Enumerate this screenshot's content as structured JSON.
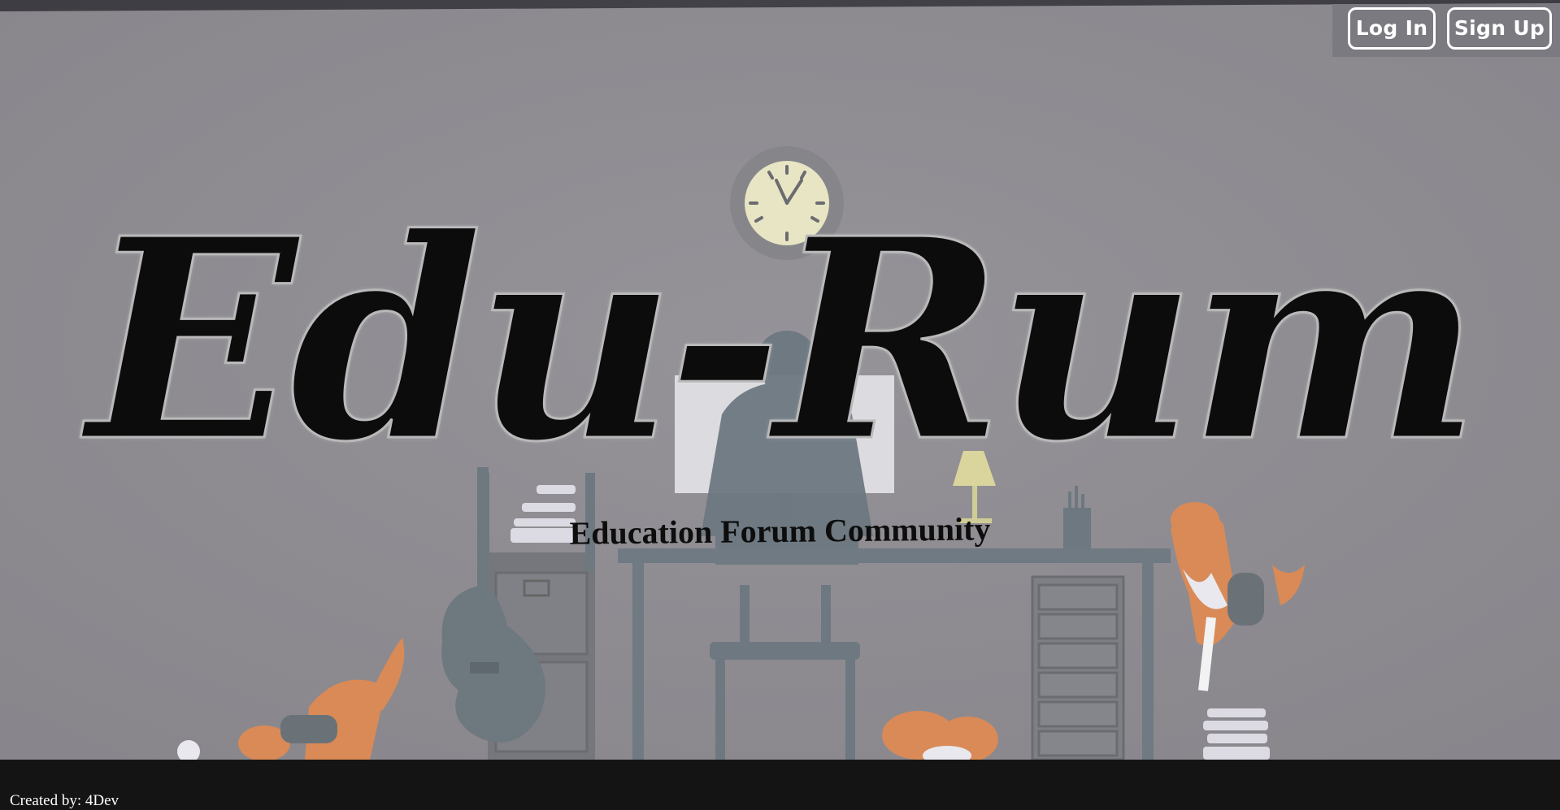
{
  "header": {
    "login_label": "Log In",
    "signup_label": "Sign Up"
  },
  "hero": {
    "title": "Edu-Rum",
    "subtitle": "Education Forum Community",
    "illustration": "person-at-desk-with-dogs-illustration"
  },
  "footer": {
    "credit": "Created by: 4Dev"
  },
  "colors": {
    "hero_bg": "#8e8c92",
    "footer_bg": "#141414",
    "title": "#0c0c0c",
    "button_border": "#ffffff",
    "dog_orange": "#d98a57"
  }
}
